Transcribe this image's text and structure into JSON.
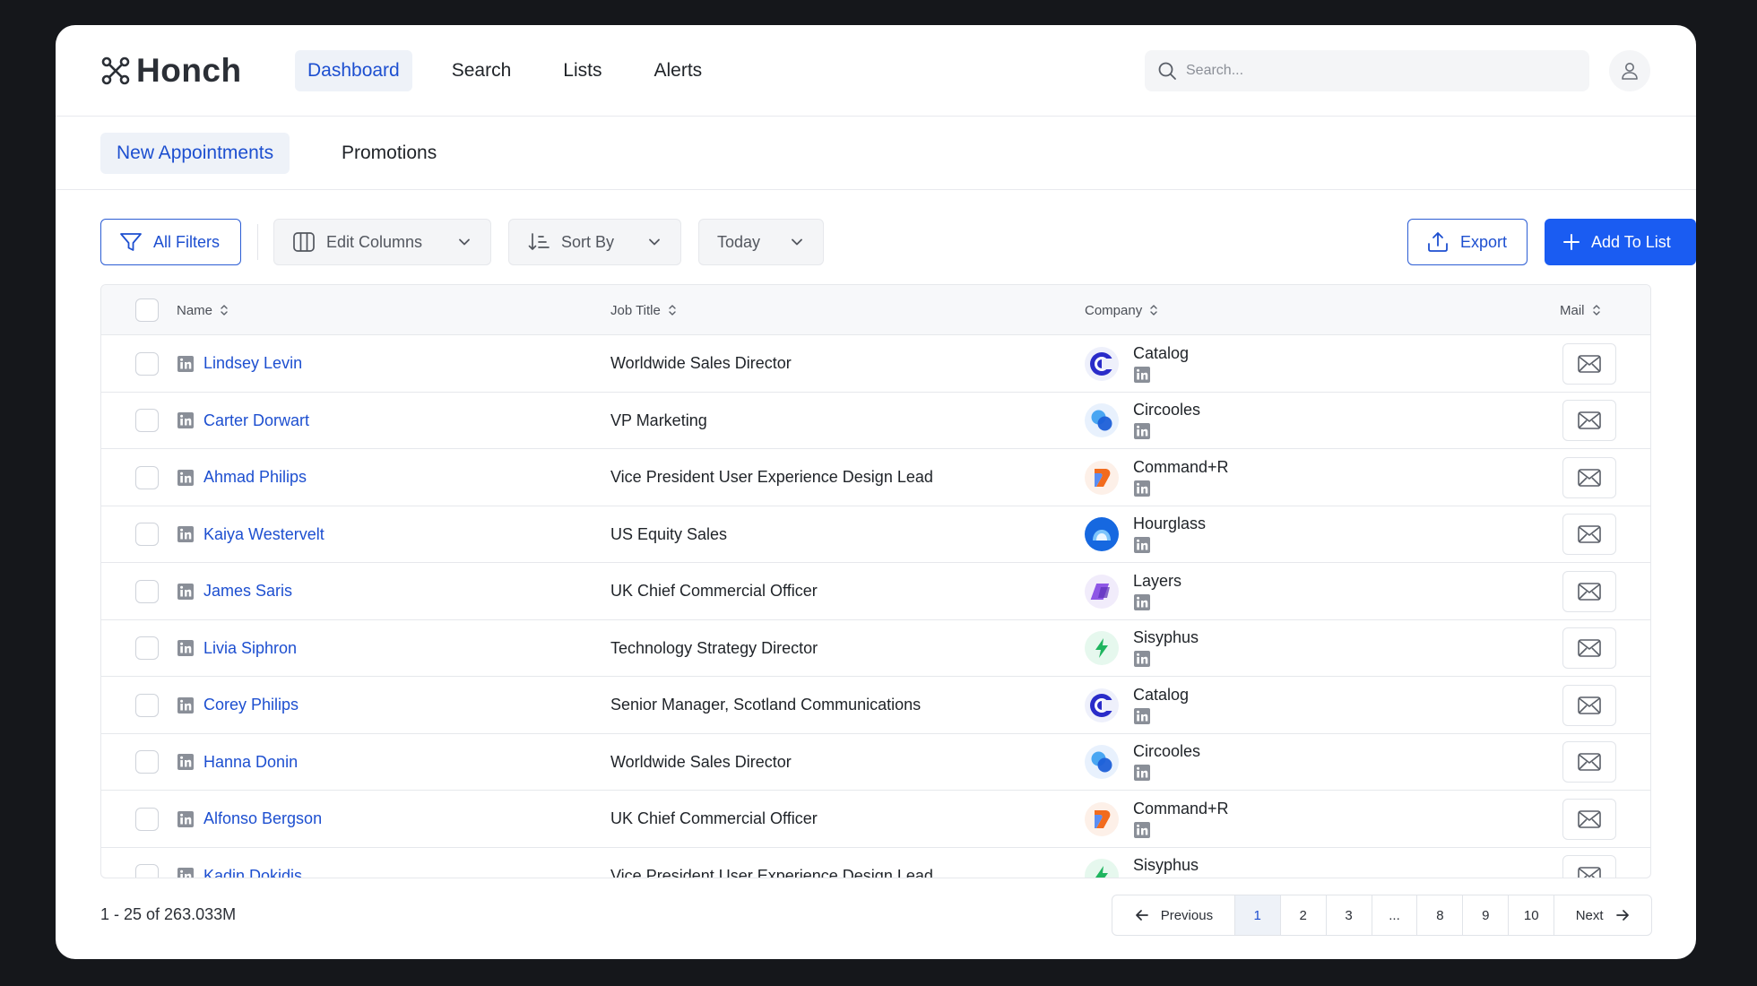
{
  "app": {
    "name": "Honch"
  },
  "nav": {
    "items": [
      {
        "label": "Dashboard",
        "active": true
      },
      {
        "label": "Search",
        "active": false
      },
      {
        "label": "Lists",
        "active": false
      },
      {
        "label": "Alerts",
        "active": false
      }
    ],
    "search_placeholder": "Search..."
  },
  "subtabs": [
    {
      "label": "New Appointments",
      "active": true
    },
    {
      "label": "Promotions",
      "active": false
    }
  ],
  "toolbar": {
    "filters_label": "All Filters",
    "edit_columns_label": "Edit Columns",
    "sort_by_label": "Sort By",
    "date_label": "Today",
    "export_label": "Export",
    "add_to_list_label": "Add To List"
  },
  "table": {
    "headers": {
      "name": "Name",
      "job_title": "Job Title",
      "company": "Company",
      "mail": "Mail"
    },
    "rows": [
      {
        "name": "Lindsey Levin",
        "title": "Worldwide Sales Director",
        "company": "Catalog",
        "logo": "catalog"
      },
      {
        "name": "Carter Dorwart",
        "title": "VP Marketing",
        "company": "Circooles",
        "logo": "circooles"
      },
      {
        "name": "Ahmad Philips",
        "title": "Vice President User Experience Design Lead",
        "company": "Command+R",
        "logo": "commandr"
      },
      {
        "name": "Kaiya Westervelt",
        "title": "US Equity Sales",
        "company": "Hourglass",
        "logo": "hourglass"
      },
      {
        "name": "James Saris",
        "title": "UK Chief Commercial Officer",
        "company": "Layers",
        "logo": "layers"
      },
      {
        "name": "Livia Siphron",
        "title": "Technology Strategy Director",
        "company": "Sisyphus",
        "logo": "sisyphus"
      },
      {
        "name": "Corey Philips",
        "title": "Senior Manager, Scotland Communications",
        "company": "Catalog",
        "logo": "catalog"
      },
      {
        "name": "Hanna Donin",
        "title": "Worldwide Sales Director",
        "company": "Circooles",
        "logo": "circooles"
      },
      {
        "name": "Alfonso Bergson",
        "title": "UK Chief Commercial Officer",
        "company": "Command+R",
        "logo": "commandr"
      },
      {
        "name": "Kadin Dokidis",
        "title": "Vice President User Experience Design Lead",
        "company": "Sisyphus",
        "logo": "sisyphus"
      }
    ]
  },
  "footer": {
    "count_text": "1 - 25 of 263.033M",
    "prev_label": "Previous",
    "next_label": "Next",
    "pages": [
      "1",
      "2",
      "3",
      "...",
      "8",
      "9",
      "10"
    ],
    "active_page": "1"
  },
  "colors": {
    "accent": "#1d4fd0",
    "primary_button": "#1a5cf2",
    "window_bg": "#ffffff",
    "backdrop": "#15171b"
  }
}
